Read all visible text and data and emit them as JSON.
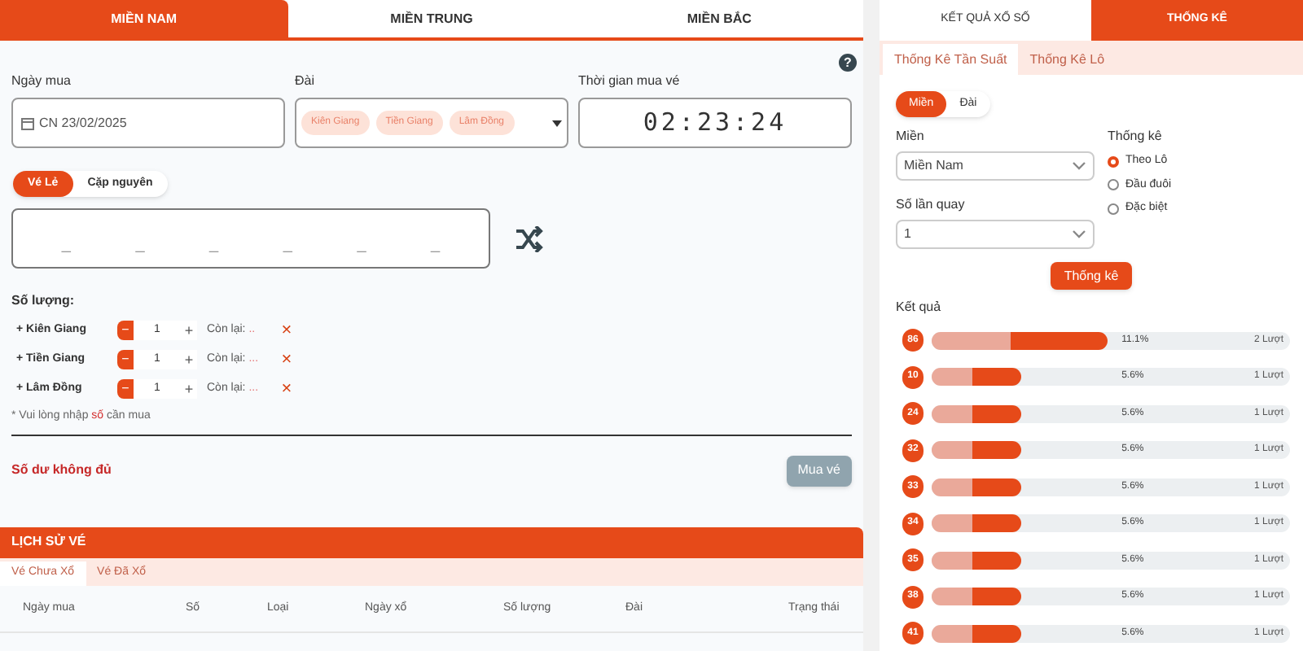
{
  "region_tabs": [
    {
      "label": "MIỀN NAM",
      "selected": true
    },
    {
      "label": "MIỀN TRUNG",
      "selected": false
    },
    {
      "label": "MIỀN BẮC",
      "selected": false
    }
  ],
  "help": "?",
  "fields": {
    "date": {
      "label": "Ngày mua",
      "value": "CN 23/02/2025"
    },
    "station": {
      "label": "Đài",
      "tags": [
        "Kiên Giang",
        "Tiền Giang",
        "Lâm Đồng"
      ]
    },
    "time": {
      "label": "Thời gian mua vé",
      "value": "02:23:24"
    }
  },
  "ticket_types": [
    {
      "label": "Vé Lẻ",
      "selected": true
    },
    {
      "label": "Cặp nguyên",
      "selected": false
    }
  ],
  "digits": [
    "_",
    "_",
    "_",
    "_",
    "_",
    "_"
  ],
  "quantity": {
    "label": "Số lượng:",
    "rows": [
      {
        "name": "+ Kiên Giang",
        "value": "1",
        "remaining_label": "Còn lại:",
        "remaining": "..",
        "minus": "−",
        "plus": "+",
        "remove": "×"
      },
      {
        "name": "+ Tiền Giang",
        "value": "1",
        "remaining_label": "Còn lại:",
        "remaining": "...",
        "minus": "−",
        "plus": "+",
        "remove": "×"
      },
      {
        "name": "+ Lâm Đồng",
        "value": "1",
        "remaining_label": "Còn lại:",
        "remaining": "...",
        "minus": "−",
        "plus": "+",
        "remove": "×"
      }
    ]
  },
  "note": "* Vui lòng nhập **số** cần mua",
  "balance_warning": "Số dư không đủ",
  "buy_button": {
    "label": "Mua vé",
    "disabled": true
  },
  "history": {
    "title": "LỊCH SỬ VÉ",
    "tabs": [
      {
        "label": "Vé Chưa Xổ",
        "selected": true
      },
      {
        "label": "Vé Đã Xổ",
        "selected": false
      }
    ],
    "columns": [
      "Ngày mua",
      "Số",
      "Loại",
      "Ngày xổ",
      "Số lượng",
      "Đài",
      "Trạng thái"
    ]
  },
  "side_tabs": [
    {
      "label": "KẾT QUẢ XỔ SỐ",
      "selected": false
    },
    {
      "label": "THỐNG KÊ",
      "selected": true
    }
  ],
  "stat_tabs": [
    {
      "label": "Thống Kê Tần Suất",
      "selected": true
    },
    {
      "label": "Thống Kê Lô",
      "selected": false
    }
  ],
  "scope_toggle": [
    {
      "label": "Miền",
      "selected": true
    },
    {
      "label": "Đài",
      "selected": false
    }
  ],
  "region_select": {
    "label": "Miền",
    "value": "Miền Nam"
  },
  "spins_select": {
    "label": "Số lần quay",
    "value": "1"
  },
  "stat_type": {
    "label": "Thống kê",
    "options": [
      {
        "label": "Theo Lô",
        "selected": true
      },
      {
        "label": "Đầu đuôi",
        "selected": false
      },
      {
        "label": "Đặc biệt",
        "selected": false
      }
    ]
  },
  "stat_button": "Thống kê",
  "results": {
    "label": "Kết quả",
    "rows": [
      {
        "number": "86",
        "level": 0.49,
        "percent": "11.1%",
        "count": "2 Lượt"
      },
      {
        "number": "10",
        "level": 0.25,
        "percent": "5.6%",
        "count": "1 Lượt"
      },
      {
        "number": "24",
        "level": 0.25,
        "percent": "5.6%",
        "count": "1 Lượt"
      },
      {
        "number": "32",
        "level": 0.25,
        "percent": "5.6%",
        "count": "1 Lượt"
      },
      {
        "number": "33",
        "level": 0.25,
        "percent": "5.6%",
        "count": "1 Lượt"
      },
      {
        "number": "34",
        "level": 0.25,
        "percent": "5.6%",
        "count": "1 Lượt"
      },
      {
        "number": "35",
        "level": 0.25,
        "percent": "5.6%",
        "count": "1 Lượt"
      },
      {
        "number": "38",
        "level": 0.25,
        "percent": "5.6%",
        "count": "1 Lượt"
      },
      {
        "number": "41",
        "level": 0.25,
        "percent": "5.6%",
        "count": "1 Lượt"
      }
    ]
  }
}
